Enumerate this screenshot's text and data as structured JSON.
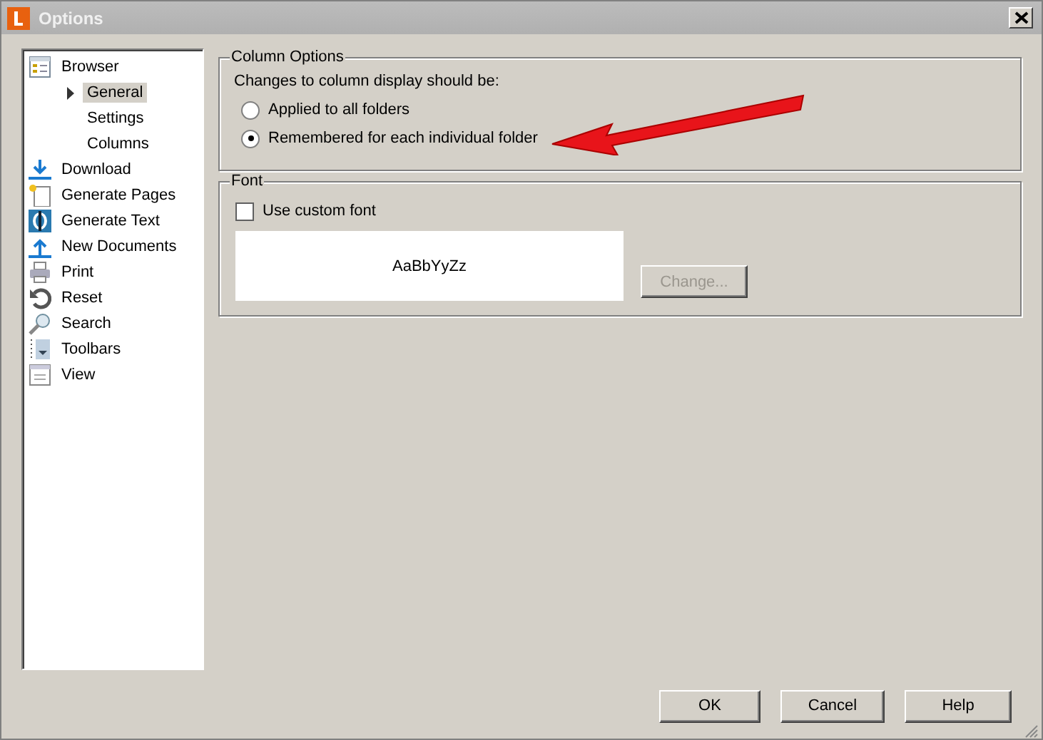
{
  "window": {
    "title": "Options"
  },
  "sidebar": {
    "items": [
      {
        "label": "Browser",
        "selected": false,
        "children": [
          {
            "label": "General",
            "selected": true
          },
          {
            "label": "Settings",
            "selected": false
          },
          {
            "label": "Columns",
            "selected": false
          }
        ]
      },
      {
        "label": "Download",
        "selected": false
      },
      {
        "label": "Generate Pages",
        "selected": false
      },
      {
        "label": "Generate Text",
        "selected": false
      },
      {
        "label": "New Documents",
        "selected": false
      },
      {
        "label": "Print",
        "selected": false
      },
      {
        "label": "Reset",
        "selected": false
      },
      {
        "label": "Search",
        "selected": false
      },
      {
        "label": "Toolbars",
        "selected": false
      },
      {
        "label": "View",
        "selected": false
      }
    ]
  },
  "column_options": {
    "title": "Column Options",
    "prompt": "Changes to column display should be:",
    "options": [
      {
        "label": "Applied to all folders",
        "selected": false
      },
      {
        "label": "Remembered for each individual folder",
        "selected": true
      }
    ]
  },
  "font": {
    "title": "Font",
    "use_custom": {
      "label": "Use custom font",
      "checked": false
    },
    "preview": "AaBbYyZz",
    "change_button": {
      "label": "Change...",
      "disabled": true
    }
  },
  "buttons": [
    "OK",
    "Cancel",
    "Help"
  ]
}
